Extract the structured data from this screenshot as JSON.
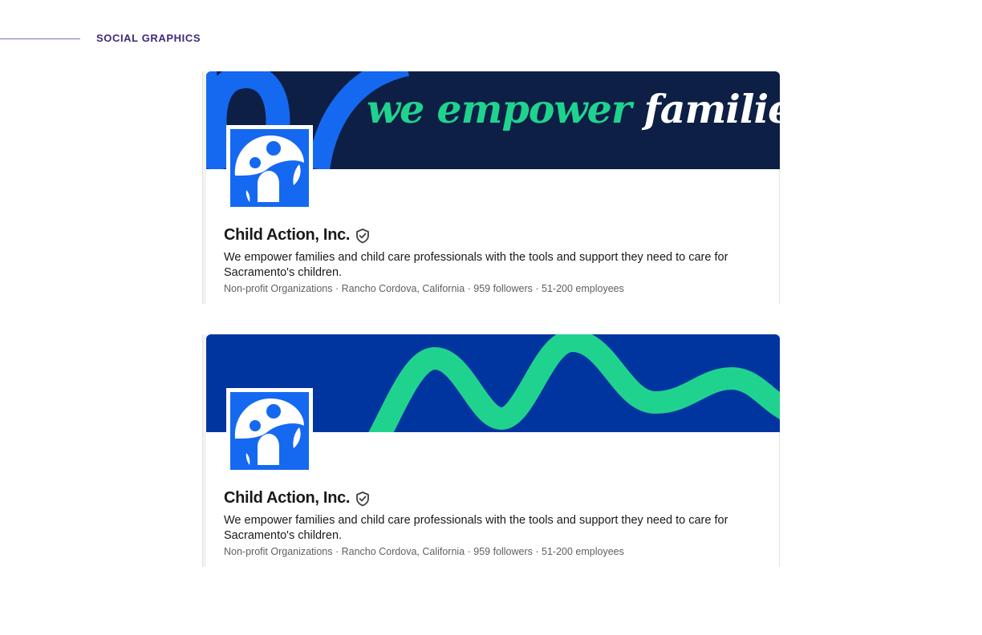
{
  "section": {
    "title": "SOCIAL GRAPHICS"
  },
  "colors": {
    "section_title": "#3f2a7c",
    "banner_navy": "#0d1f45",
    "banner_blue": "#0035a0",
    "brand_blue": "#1469f0",
    "brand_green": "#1fd38f"
  },
  "cards": [
    {
      "banner": {
        "tagline_accent": "we empower",
        "tagline_light": "families"
      },
      "logo_icon": "child-action-logo",
      "org_name": "Child Action, Inc.",
      "verified_icon": "verified-shield-icon",
      "tagline": "We empower families and child care professionals with the tools and support they need to care for Sacramento's children.",
      "meta": "Non-profit Organizations · Rancho Cordova, California · 959 followers · 51-200 employees"
    },
    {
      "banner": {
        "decoration": "green-wave"
      },
      "logo_icon": "child-action-logo",
      "org_name": "Child Action, Inc.",
      "verified_icon": "verified-shield-icon",
      "tagline": "We empower families and child care professionals with the tools and support they need to care for Sacramento's children.",
      "meta": "Non-profit Organizations · Rancho Cordova, California · 959 followers · 51-200 employees"
    }
  ]
}
